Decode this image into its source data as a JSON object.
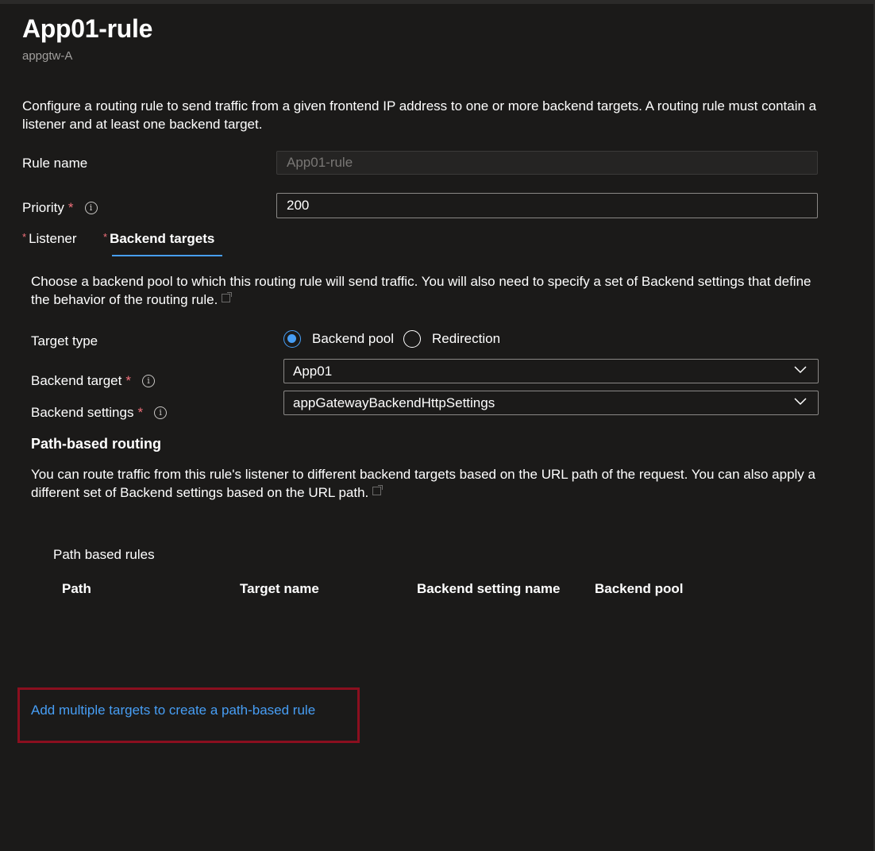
{
  "header": {
    "title": "App01-rule",
    "subtitle": "appgtw-A"
  },
  "description": "Configure a routing rule to send traffic from a given frontend IP address to one or more backend targets. A routing rule must contain a listener and at least one backend target.",
  "form": {
    "rule_name_label": "Rule name",
    "rule_name_value": "App01-rule",
    "priority_label": "Priority",
    "priority_value": "200",
    "required_mark": "*",
    "info_glyph": "i"
  },
  "tabs": [
    {
      "label": "Listener",
      "active": false
    },
    {
      "label": "Backend targets",
      "active": true
    }
  ],
  "backend_targets": {
    "description": "Choose a backend pool to which this routing rule will send traffic. You will also need to specify a set of Backend settings that define the behavior of the routing rule.",
    "target_type_label": "Target type",
    "target_type_options": [
      "Backend pool",
      "Redirection"
    ],
    "target_type_selected": "Backend pool",
    "backend_target_label": "Backend target",
    "backend_target_value": "App01",
    "backend_settings_label": "Backend settings",
    "backend_settings_value": "appGatewayBackendHttpSettings"
  },
  "path_routing": {
    "heading": "Path-based routing",
    "description": "You can route traffic from this rule's listener to different backend targets based on the URL path of the request. You can also apply a different set of Backend settings based on the URL path.",
    "grid_title": "Path based rules",
    "columns": [
      "Path",
      "Target name",
      "Backend setting name",
      "Backend pool"
    ],
    "rows": [],
    "add_link": "Add multiple targets to create a path-based rule"
  },
  "colors": {
    "background": "#1b1a19",
    "accent": "#479ef5",
    "required": "#f1707b",
    "highlight_border": "#8b0f1f"
  }
}
